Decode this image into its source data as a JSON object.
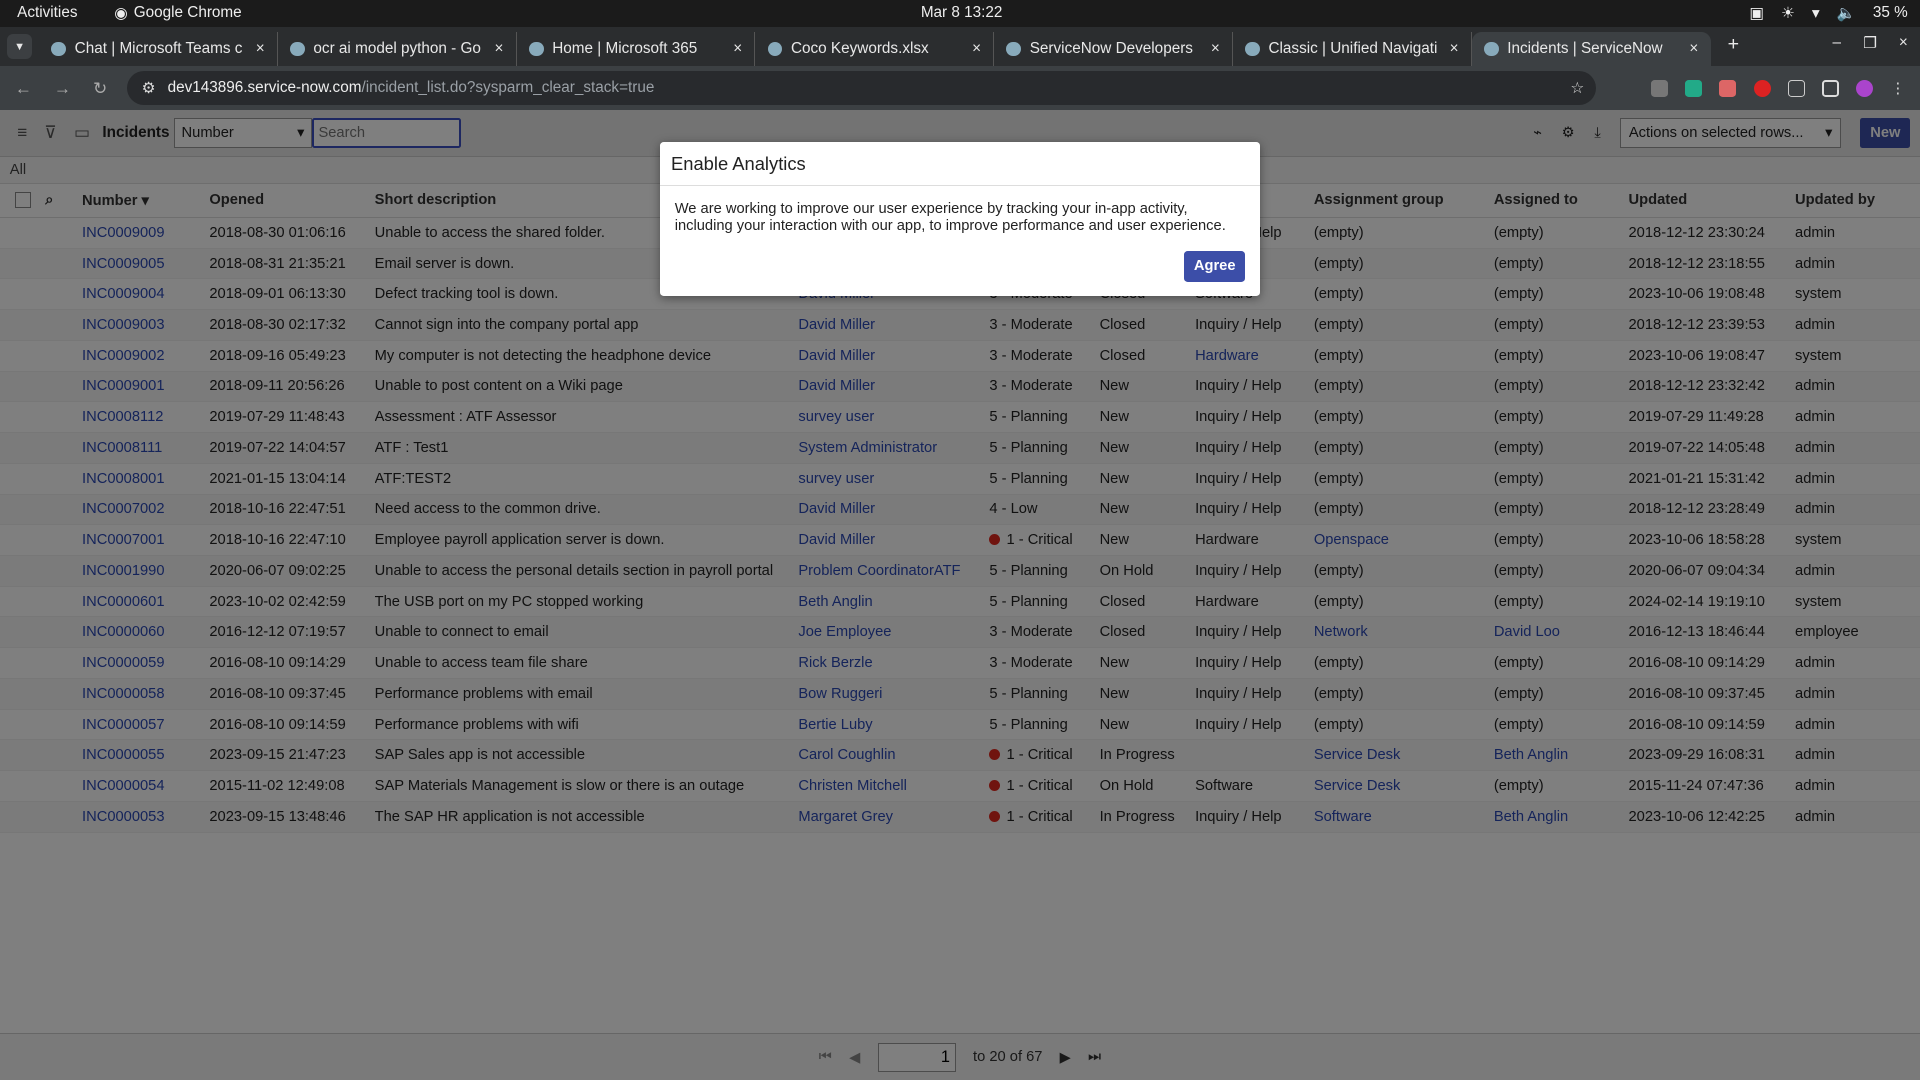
{
  "os": {
    "activities": "Activities",
    "app": "Google Chrome",
    "clock": "Mar 8  13:22",
    "battery": "35 %"
  },
  "browser": {
    "tabs": [
      {
        "label": "Chat | Microsoft Teams c"
      },
      {
        "label": "ocr ai model python - Go"
      },
      {
        "label": "Home | Microsoft 365"
      },
      {
        "label": "Coco Keywords.xlsx"
      },
      {
        "label": "ServiceNow Developers"
      },
      {
        "label": "Classic | Unified Navigati"
      },
      {
        "label": "Incidents | ServiceNow",
        "active": true
      }
    ],
    "url_host": "dev143896.service-now.com",
    "url_path": "/incident_list.do?sysparm_clear_stack=true"
  },
  "toolbar": {
    "title": "Incidents",
    "field_select": "Number",
    "search_placeholder": "Search",
    "actions_select": "Actions on selected rows...",
    "new_label": "New"
  },
  "breadcrumb": "All",
  "columns": [
    "Number",
    "Opened",
    "Short description",
    "",
    "",
    "",
    "",
    "Assignment group",
    "Assigned to",
    "Updated",
    "Updated by"
  ],
  "rows": [
    {
      "number": "INC0009009",
      "opened": "2018-08-30 01:06:16",
      "desc": "Unable to access the shared folder.",
      "caller": "",
      "priority": "",
      "state": "",
      "category": "Inquiry / Help",
      "group": "(empty)",
      "assigned": "(empty)",
      "updated": "2018-12-12 23:30:24",
      "by": "admin"
    },
    {
      "number": "INC0009005",
      "opened": "2018-08-31 21:35:21",
      "desc": "Email server is down.",
      "caller": "",
      "priority": "",
      "state": "",
      "category": "",
      "group": "(empty)",
      "assigned": "(empty)",
      "updated": "2018-12-12 23:18:55",
      "by": "admin"
    },
    {
      "number": "INC0009004",
      "opened": "2018-09-01 06:13:30",
      "desc": "Defect tracking tool is down.",
      "caller": "David Miller",
      "priority": "3 - Moderate",
      "state": "Closed",
      "category": "Software",
      "group": "(empty)",
      "assigned": "(empty)",
      "updated": "2023-10-06 19:08:48",
      "by": "system"
    },
    {
      "number": "INC0009003",
      "opened": "2018-08-30 02:17:32",
      "desc": "Cannot sign into the company portal app",
      "caller": "David Miller",
      "priority": "3 - Moderate",
      "state": "Closed",
      "category": "Inquiry / Help",
      "group": "(empty)",
      "assigned": "(empty)",
      "updated": "2018-12-12 23:39:53",
      "by": "admin"
    },
    {
      "number": "INC0009002",
      "opened": "2018-09-16 05:49:23",
      "desc": "My computer is not detecting the headphone device",
      "caller": "David Miller",
      "priority": "3 - Moderate",
      "state": "Closed",
      "category": "Hardware",
      "category_is_link": true,
      "group": "(empty)",
      "assigned": "(empty)",
      "updated": "2023-10-06 19:08:47",
      "by": "system"
    },
    {
      "number": "INC0009001",
      "opened": "2018-09-11 20:56:26",
      "desc": "Unable to post content on a Wiki page",
      "caller": "David Miller",
      "priority": "3 - Moderate",
      "state": "New",
      "category": "Inquiry / Help",
      "group": "(empty)",
      "assigned": "(empty)",
      "updated": "2018-12-12 23:32:42",
      "by": "admin"
    },
    {
      "number": "INC0008112",
      "opened": "2019-07-29 11:48:43",
      "desc": "Assessment : ATF Assessor",
      "caller": "survey user",
      "priority": "5 - Planning",
      "state": "New",
      "category": "Inquiry / Help",
      "group": "(empty)",
      "assigned": "(empty)",
      "updated": "2019-07-29 11:49:28",
      "by": "admin"
    },
    {
      "number": "INC0008111",
      "opened": "2019-07-22 14:04:57",
      "desc": "ATF : Test1",
      "caller": "System Administrator",
      "priority": "5 - Planning",
      "state": "New",
      "category": "Inquiry / Help",
      "group": "(empty)",
      "assigned": "(empty)",
      "updated": "2019-07-22 14:05:48",
      "by": "admin"
    },
    {
      "number": "INC0008001",
      "opened": "2021-01-15 13:04:14",
      "desc": "ATF:TEST2",
      "caller": "survey user",
      "priority": "5 - Planning",
      "state": "New",
      "category": "Inquiry / Help",
      "group": "(empty)",
      "assigned": "(empty)",
      "updated": "2021-01-21 15:31:42",
      "by": "admin"
    },
    {
      "number": "INC0007002",
      "opened": "2018-10-16 22:47:51",
      "desc": "Need access to the common drive.",
      "caller": "David Miller",
      "priority": "4 - Low",
      "state": "New",
      "category": "Inquiry / Help",
      "group": "(empty)",
      "assigned": "(empty)",
      "updated": "2018-12-12 23:28:49",
      "by": "admin"
    },
    {
      "number": "INC0007001",
      "opened": "2018-10-16 22:47:10",
      "desc": "Employee payroll application server is down.",
      "caller": "David Miller",
      "priority": "1 - Critical",
      "state": "New",
      "category": "Hardware",
      "group": "Openspace",
      "assigned": "(empty)",
      "updated": "2023-10-06 18:58:28",
      "by": "system"
    },
    {
      "number": "INC0001990",
      "opened": "2020-06-07 09:02:25",
      "desc": "Unable to access the personal details section in payroll portal",
      "caller": "Problem CoordinatorATF",
      "priority": "5 - Planning",
      "state": "On Hold",
      "category": "Inquiry / Help",
      "group": "(empty)",
      "assigned": "(empty)",
      "updated": "2020-06-07 09:04:34",
      "by": "admin"
    },
    {
      "number": "INC0000601",
      "opened": "2023-10-02 02:42:59",
      "desc": "The USB port on my PC stopped working",
      "caller": "Beth Anglin",
      "priority": "5 - Planning",
      "state": "Closed",
      "category": "Hardware",
      "group": "(empty)",
      "assigned": "(empty)",
      "updated": "2024-02-14 19:19:10",
      "by": "system"
    },
    {
      "number": "INC0000060",
      "opened": "2016-12-12 07:19:57",
      "desc": "Unable to connect to email",
      "caller": "Joe Employee",
      "priority": "3 - Moderate",
      "state": "Closed",
      "category": "Inquiry / Help",
      "group": "Network",
      "assigned": "David Loo",
      "updated": "2016-12-13 18:46:44",
      "by": "employee"
    },
    {
      "number": "INC0000059",
      "opened": "2016-08-10 09:14:29",
      "desc": "Unable to access team file share",
      "caller": "Rick Berzle",
      "priority": "3 - Moderate",
      "state": "New",
      "category": "Inquiry / Help",
      "group": "(empty)",
      "assigned": "(empty)",
      "updated": "2016-08-10 09:14:29",
      "by": "admin"
    },
    {
      "number": "INC0000058",
      "opened": "2016-08-10 09:37:45",
      "desc": "Performance problems with email",
      "caller": "Bow Ruggeri",
      "priority": "5 - Planning",
      "state": "New",
      "category": "Inquiry / Help",
      "group": "(empty)",
      "assigned": "(empty)",
      "updated": "2016-08-10 09:37:45",
      "by": "admin"
    },
    {
      "number": "INC0000057",
      "opened": "2016-08-10 09:14:59",
      "desc": "Performance problems with wifi",
      "caller": "Bertie Luby",
      "priority": "5 - Planning",
      "state": "New",
      "category": "Inquiry / Help",
      "group": "(empty)",
      "assigned": "(empty)",
      "updated": "2016-08-10 09:14:59",
      "by": "admin"
    },
    {
      "number": "INC0000055",
      "opened": "2023-09-15 21:47:23",
      "desc": "SAP Sales app is not accessible",
      "caller": "Carol Coughlin",
      "priority": "1 - Critical",
      "state": "In Progress",
      "category": "",
      "group": "Service Desk",
      "assigned": "Beth Anglin",
      "updated": "2023-09-29 16:08:31",
      "by": "admin"
    },
    {
      "number": "INC0000054",
      "opened": "2015-11-02 12:49:08",
      "desc": "SAP Materials Management is slow or there is an outage",
      "caller": "Christen Mitchell",
      "priority": "1 - Critical",
      "state": "On Hold",
      "category": "Software",
      "group": "Service Desk",
      "assigned": "(empty)",
      "updated": "2015-11-24 07:47:36",
      "by": "admin"
    },
    {
      "number": "INC0000053",
      "opened": "2023-09-15 13:48:46",
      "desc": "The SAP HR application is not accessible",
      "caller": "Margaret Grey",
      "priority": "1 - Critical",
      "state": "In Progress",
      "category": "Inquiry / Help",
      "group": "Software",
      "assigned": "Beth Anglin",
      "updated": "2023-10-06 12:42:25",
      "by": "admin"
    }
  ],
  "pagination": {
    "page": "1",
    "range": "to 20 of 67"
  },
  "modal": {
    "title": "Enable Analytics",
    "body": "We are working to improve our user experience by tracking your in-app activity, including your interaction with our app, to improve performance and user experience.",
    "agree": "Agree"
  },
  "colors": {
    "accent": "#3c4ea8",
    "link": "#2b48b5",
    "critical": "#e1281f"
  }
}
